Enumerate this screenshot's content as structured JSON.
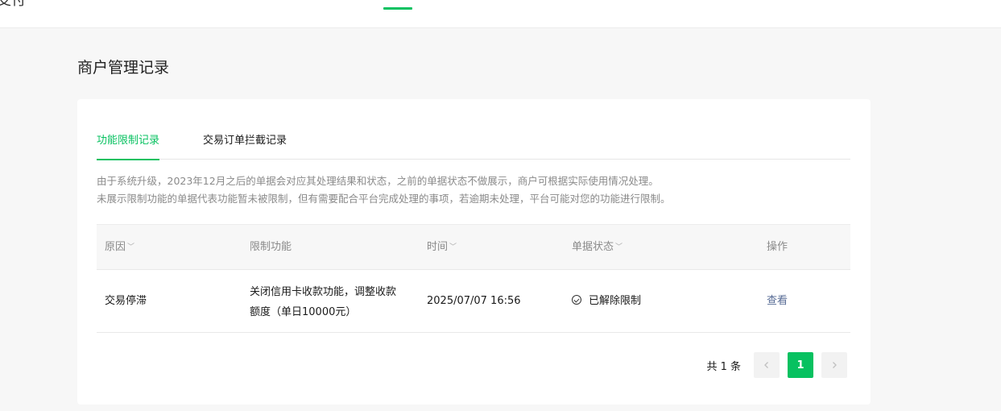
{
  "topbar": {
    "title": "支付"
  },
  "page": {
    "title": "商户管理记录"
  },
  "tabs": [
    {
      "label": "功能限制记录",
      "active": true
    },
    {
      "label": "交易订单拦截记录",
      "active": false
    }
  ],
  "notice": {
    "line1": "由于系统升级，2023年12月之后的单据会对应其处理结果和状态，之前的单据状态不做展示，商户可根据实际使用情况处理。",
    "line2": "未展示限制功能的单据代表功能暂未被限制，但有需要配合平台完成处理的事项，若逾期未处理，平台可能对您的功能进行限制。"
  },
  "table": {
    "headers": {
      "reason": "原因",
      "feature": "限制功能",
      "time": "时间",
      "status": "单据状态",
      "action": "操作"
    },
    "rows": [
      {
        "reason": "交易停滞",
        "feature_line1": "关闭信用卡收款功能，调整收款",
        "feature_line2": "额度（单日10000元）",
        "time": "2025/07/07 16:56",
        "status": "已解除限制",
        "action": "查看"
      }
    ]
  },
  "pagination": {
    "total": "共 1 条",
    "prev_icon": "chevron-left-icon",
    "next_icon": "chevron-right-icon",
    "current_page": "1"
  },
  "colors": {
    "accent": "#07c160",
    "link": "#576b95",
    "muted_text": "#8a8a8a"
  }
}
